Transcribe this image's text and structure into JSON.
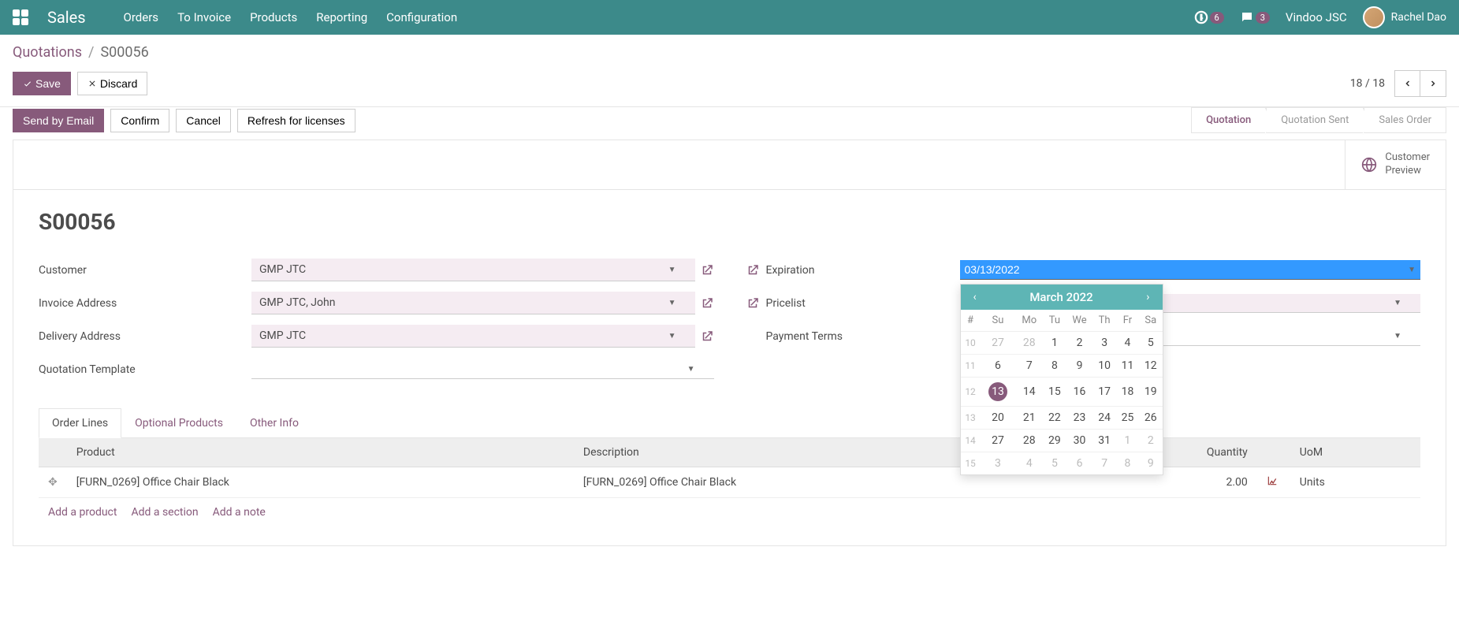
{
  "navbar": {
    "brand": "Sales",
    "menu": [
      "Orders",
      "To Invoice",
      "Products",
      "Reporting",
      "Configuration"
    ],
    "activity_badge": "6",
    "msg_badge": "3",
    "company": "Vindoo JSC",
    "user": "Rachel Dao"
  },
  "breadcrumb": {
    "root": "Quotations",
    "current": "S00056"
  },
  "buttons": {
    "save": "Save",
    "discard": "Discard"
  },
  "pager": {
    "text": "18 / 18"
  },
  "actions": {
    "send_email": "Send by Email",
    "confirm": "Confirm",
    "cancel": "Cancel",
    "refresh": "Refresh for licenses"
  },
  "status": {
    "steps": [
      "Quotation",
      "Quotation Sent",
      "Sales Order"
    ],
    "active_index": 0
  },
  "stat_button": {
    "line1": "Customer",
    "line2": "Preview"
  },
  "record_title": "S00056",
  "fields": {
    "customer": {
      "label": "Customer",
      "value": "GMP JTC"
    },
    "invoice_address": {
      "label": "Invoice Address",
      "value": "GMP JTC, John"
    },
    "delivery_address": {
      "label": "Delivery Address",
      "value": "GMP JTC"
    },
    "quotation_template": {
      "label": "Quotation Template",
      "value": ""
    },
    "expiration": {
      "label": "Expiration",
      "value": "03/13/2022"
    },
    "pricelist": {
      "label": "Pricelist",
      "value": ""
    },
    "payment_terms": {
      "label": "Payment Terms",
      "value": ""
    }
  },
  "tabs": [
    "Order Lines",
    "Optional Products",
    "Other Info"
  ],
  "table": {
    "headers": {
      "product": "Product",
      "description": "Description",
      "quantity": "Quantity",
      "uom": "UoM"
    },
    "row": {
      "product": "[FURN_0269] Office Chair Black",
      "description": "[FURN_0269] Office Chair Black",
      "quantity": "2.00",
      "uom": "Units"
    },
    "add_links": {
      "product": "Add a product",
      "section": "Add a section",
      "note": "Add a note"
    }
  },
  "datepicker": {
    "month": "March 2022",
    "dow": [
      "#",
      "Su",
      "Mo",
      "Tu",
      "We",
      "Th",
      "Fr",
      "Sa"
    ],
    "weeks": [
      {
        "w": "10",
        "d": [
          "27",
          "28",
          "1",
          "2",
          "3",
          "4",
          "5"
        ],
        "muted": [
          0,
          1
        ]
      },
      {
        "w": "11",
        "d": [
          "6",
          "7",
          "8",
          "9",
          "10",
          "11",
          "12"
        ],
        "muted": []
      },
      {
        "w": "12",
        "d": [
          "13",
          "14",
          "15",
          "16",
          "17",
          "18",
          "19"
        ],
        "muted": [],
        "selected": 0
      },
      {
        "w": "13",
        "d": [
          "20",
          "21",
          "22",
          "23",
          "24",
          "25",
          "26"
        ],
        "muted": []
      },
      {
        "w": "14",
        "d": [
          "27",
          "28",
          "29",
          "30",
          "31",
          "1",
          "2"
        ],
        "muted": [
          5,
          6
        ]
      },
      {
        "w": "15",
        "d": [
          "3",
          "4",
          "5",
          "6",
          "7",
          "8",
          "9"
        ],
        "muted": [
          0,
          1,
          2,
          3,
          4,
          5,
          6
        ]
      }
    ]
  }
}
